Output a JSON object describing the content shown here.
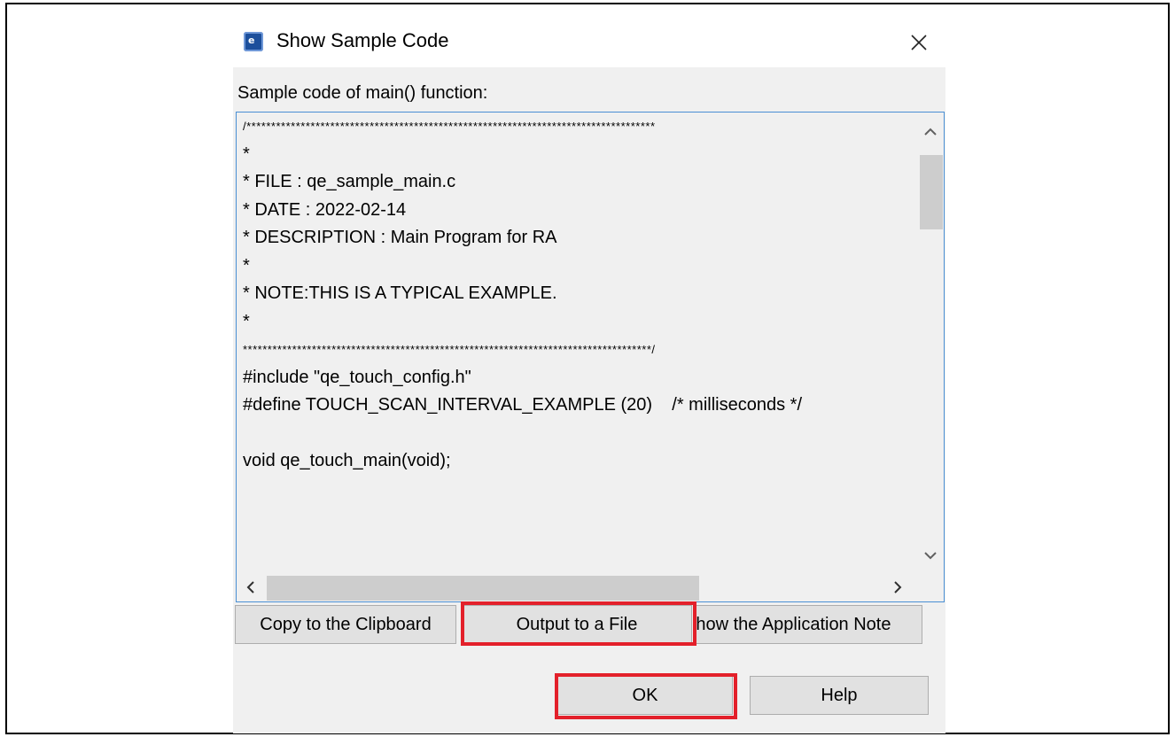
{
  "dialog": {
    "title": "Show Sample Code",
    "caption": "Sample code of main() function:"
  },
  "code": {
    "lines": [
      "/***********************************************************************************",
      "*",
      "* FILE : qe_sample_main.c",
      "* DATE : 2022-02-14",
      "* DESCRIPTION : Main Program for RA",
      "*",
      "* NOTE:THIS IS A TYPICAL EXAMPLE.",
      "*",
      "***********************************************************************************/",
      "#include \"qe_touch_config.h\"",
      "#define TOUCH_SCAN_INTERVAL_EXAMPLE (20)    /* milliseconds */",
      "",
      "void qe_touch_main(void);",
      "",
      ""
    ]
  },
  "buttons": {
    "copy": "Copy to the Clipboard",
    "output": "Output to a File",
    "appnote": "Show the Application Note",
    "ok": "OK",
    "help": "Help"
  },
  "colors": {
    "highlight": "#e3202a",
    "code_border": "#4a8fd4",
    "dialog_bg": "#f0f0f0"
  },
  "icons": {
    "app": "e2-studio-icon",
    "close": "close-icon"
  }
}
